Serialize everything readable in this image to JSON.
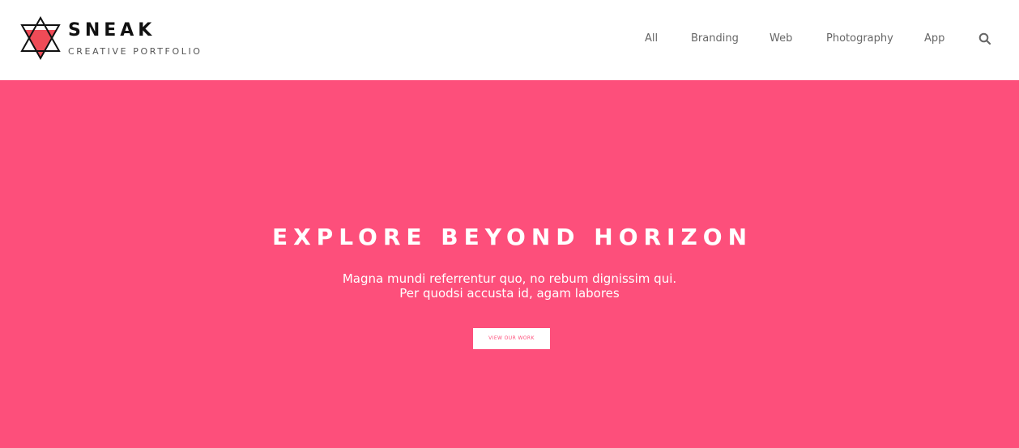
{
  "brand": {
    "name": "SNEAK",
    "tagline": "CREATIVE PORTFOLIO",
    "logo_icon": "star-of-david-icon"
  },
  "nav": {
    "items": [
      {
        "label": "All"
      },
      {
        "label": "Branding"
      },
      {
        "label": "Web"
      },
      {
        "label": "Photography"
      },
      {
        "label": "App"
      }
    ],
    "search_icon": "search-icon"
  },
  "hero": {
    "title": "EXPLORE BEYOND HORIZON",
    "text_line1": "Magna mundi referrentur quo, no rebum dignissim qui.",
    "text_line2": "Per quodsi accusta id, agam labores",
    "button_label": "VIEW OUR WORK"
  },
  "colors": {
    "accent": "#fd4f7b",
    "logo_red": "#ef4b57",
    "text_dark": "#111111",
    "nav_text": "#666666"
  }
}
